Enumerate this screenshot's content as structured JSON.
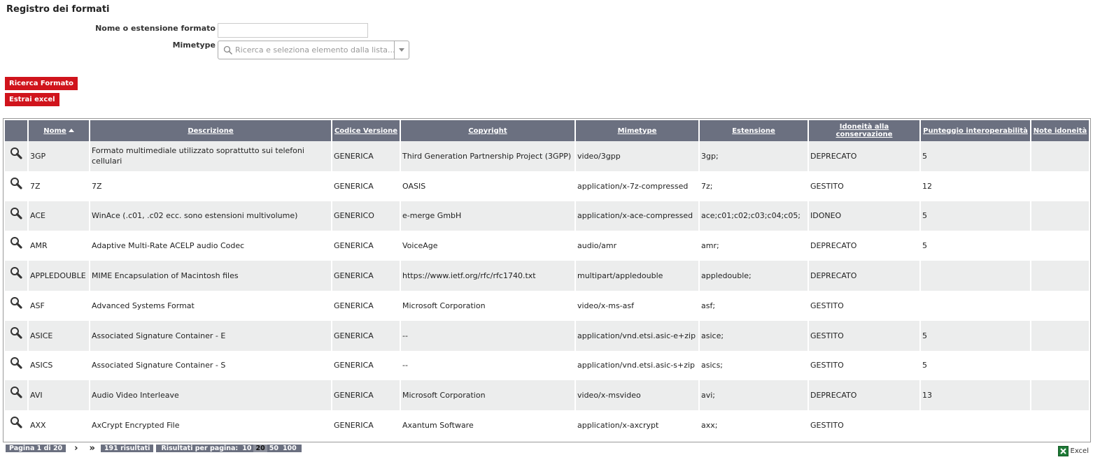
{
  "page": {
    "title": "Registro dei formati"
  },
  "form": {
    "name_label": "Nome o estensione formato",
    "name_value": "",
    "mimetype_label": "Mimetype",
    "mimetype_placeholder": "Ricerca e seleziona elemento dalla lista..."
  },
  "actions": {
    "search_label": "Ricerca Formato",
    "excel_label": "Estrai excel"
  },
  "table": {
    "headers": {
      "nome": "Nome",
      "descrizione": "Descrizione",
      "codice_versione": "Codice Versione",
      "copyright": "Copyright",
      "mimetype": "Mimetype",
      "estensione": "Estensione",
      "idoneita": "Idoneità alla conservazione",
      "punteggio": "Punteggio interoperabilità",
      "note": "Note idoneità"
    },
    "rows": [
      {
        "nome": "3GP",
        "descrizione": "Formato multimediale utilizzato soprattutto sui telefoni cellulari",
        "codice": "GENERICA",
        "copyright": "Third Generation Partnership Project (3GPP)",
        "mimetype": "video/3gpp",
        "estensione": "3gp;",
        "idoneita": "DEPRECATO",
        "punteggio": "5",
        "note": ""
      },
      {
        "nome": "7Z",
        "descrizione": "7Z",
        "codice": "GENERICA",
        "copyright": "OASIS",
        "mimetype": "application/x-7z-compressed",
        "estensione": "7z;",
        "idoneita": "GESTITO",
        "punteggio": "12",
        "note": ""
      },
      {
        "nome": "ACE",
        "descrizione": "WinAce (.c01, .c02 ecc. sono estensioni multivolume)",
        "codice": "GENERICO",
        "copyright": "e-merge GmbH",
        "mimetype": "application/x-ace-compressed",
        "estensione": "ace;c01;c02;c03;c04;c05;",
        "idoneita": "IDONEO",
        "punteggio": "5",
        "note": ""
      },
      {
        "nome": "AMR",
        "descrizione": "Adaptive Multi-Rate ACELP audio Codec",
        "codice": "GENERICA",
        "copyright": "VoiceAge",
        "mimetype": "audio/amr",
        "estensione": "amr;",
        "idoneita": "DEPRECATO",
        "punteggio": "5",
        "note": ""
      },
      {
        "nome": "APPLEDOUBLE",
        "descrizione": "MIME Encapsulation of Macintosh files",
        "codice": "GENERICA",
        "copyright": "https://www.ietf.org/rfc/rfc1740.txt",
        "mimetype": "multipart/appledouble",
        "estensione": "appledouble;",
        "idoneita": "DEPRECATO",
        "punteggio": "",
        "note": ""
      },
      {
        "nome": "ASF",
        "descrizione": "Advanced Systems Format",
        "codice": "GENERICA",
        "copyright": "Microsoft Corporation",
        "mimetype": "video/x-ms-asf",
        "estensione": "asf;",
        "idoneita": "GESTITO",
        "punteggio": "",
        "note": ""
      },
      {
        "nome": "ASICE",
        "descrizione": "Associated Signature Container - E",
        "codice": "GENERICA",
        "copyright": "--",
        "mimetype": "application/vnd.etsi.asic-e+zip",
        "estensione": "asice;",
        "idoneita": "GESTITO",
        "punteggio": "5",
        "note": ""
      },
      {
        "nome": "ASICS",
        "descrizione": "Associated Signature Container - S",
        "codice": "GENERICA",
        "copyright": "--",
        "mimetype": "application/vnd.etsi.asic-s+zip",
        "estensione": "asics;",
        "idoneita": "GESTITO",
        "punteggio": "5",
        "note": ""
      },
      {
        "nome": "AVI",
        "descrizione": "Audio Video Interleave",
        "codice": "GENERICA",
        "copyright": "Microsoft Corporation",
        "mimetype": "video/x-msvideo",
        "estensione": "avi;",
        "idoneita": "DEPRECATO",
        "punteggio": "13",
        "note": ""
      },
      {
        "nome": "AXX",
        "descrizione": "AxCrypt Encrypted File",
        "codice": "GENERICA",
        "copyright": "Axantum Software",
        "mimetype": "application/x-axcrypt",
        "estensione": "axx;",
        "idoneita": "GESTITO",
        "punteggio": "",
        "note": ""
      }
    ]
  },
  "pager": {
    "page_info": "Pagina 1 di 20",
    "next": "›",
    "last": "»",
    "results": "191 risultati",
    "per_page_label": "Risultati per pagina:",
    "per_page_options": [
      "10",
      "20",
      "50",
      "100"
    ],
    "per_page_selected": "20"
  },
  "excel_link": {
    "label": "Excel"
  },
  "colors": {
    "accent_red": "#d0141c",
    "header_gray": "#6b7080",
    "row_alt": "#eceded"
  },
  "icons": {
    "row_view": "magnifier-icon",
    "mimetype_search": "search-icon",
    "dropdown": "chevron-down-icon",
    "excel": "excel-icon"
  }
}
